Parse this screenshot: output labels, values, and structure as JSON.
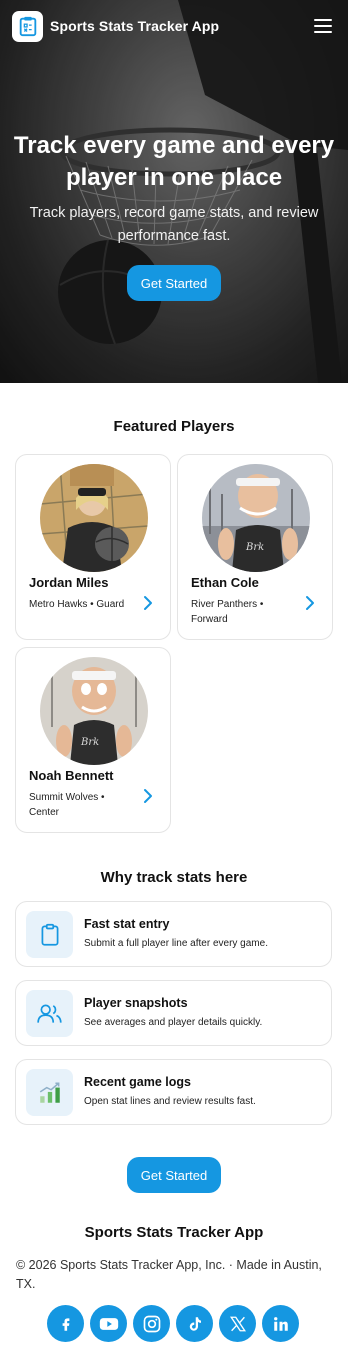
{
  "header": {
    "app_name": "Sports Stats Tracker App",
    "logo_icon": "clipboard-stats-icon",
    "menu_icon": "hamburger-menu-icon"
  },
  "hero": {
    "title": "Track every game and every player in one place",
    "subtitle": "Track players, record game stats, and review performance fast.",
    "cta_label": "Get Started"
  },
  "featured": {
    "title": "Featured Players",
    "players": [
      {
        "name": "Jordan Miles",
        "meta": "Metro Hawks • Guard"
      },
      {
        "name": "Ethan Cole",
        "meta": "River Panthers • Forward"
      },
      {
        "name": "Noah Bennett",
        "meta": "Summit Wolves • Center"
      }
    ]
  },
  "why": {
    "title": "Why track stats here",
    "items": [
      {
        "title": "Fast stat entry",
        "desc": "Submit a full player line after every game.",
        "icon": "clipboard-icon"
      },
      {
        "title": "Player snapshots",
        "desc": "See averages and player details quickly.",
        "icon": "users-icon"
      },
      {
        "title": "Recent game logs",
        "desc": "Open stat lines and review results fast.",
        "icon": "bar-chart-icon"
      }
    ]
  },
  "cta": {
    "label": "Get Started"
  },
  "footer": {
    "brand": "Sports Stats Tracker App",
    "copyright": "© 2026 Sports Stats Tracker App, Inc. · Made in Austin, TX.",
    "socials": [
      "facebook-icon",
      "youtube-icon",
      "instagram-icon",
      "tiktok-icon",
      "x-icon",
      "linkedin-icon"
    ]
  },
  "colors": {
    "accent": "#1597e1",
    "icon_tile": "#e7f2fa",
    "card_border": "#e4e4e4"
  }
}
